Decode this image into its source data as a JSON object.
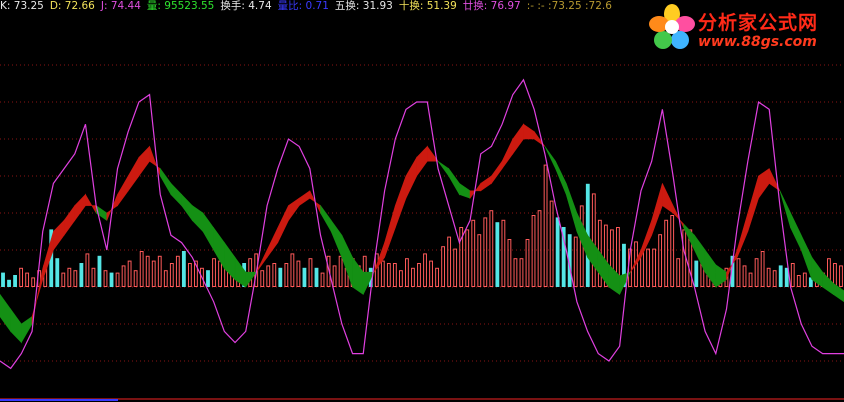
{
  "header": {
    "items": [
      {
        "label": "K",
        "value": "73.25",
        "color": "#e8e8e8"
      },
      {
        "label": "D",
        "value": "72.66",
        "color": "#f2e25a"
      },
      {
        "label": "J",
        "value": "74.44",
        "color": "#e050e0"
      },
      {
        "label": "量",
        "value": "95523.55",
        "color": "#2ee22e"
      },
      {
        "label": "换手",
        "value": "4.74",
        "color": "#e8e8e8"
      },
      {
        "label": "量比",
        "value": "0.71",
        "color": "#3a3aff"
      },
      {
        "label": "五换",
        "value": "31.93",
        "color": "#e8e8e8"
      },
      {
        "label": "十换",
        "value": "51.39",
        "color": "#f2e25a"
      },
      {
        "label": "廿换",
        "value": "76.97",
        "color": "#e050e0"
      }
    ],
    "tail": ":- :- :73.25 :72.6"
  },
  "logo": {
    "title": "分析家公式网",
    "url": "www.88gs.com"
  },
  "chart_data": {
    "type": "bar",
    "ylim": [
      0,
      100
    ],
    "grid": true,
    "colors": {
      "up_bar": "#ff5a5a",
      "down_bar": "#54e6e6",
      "kd_up_fill": "#cc1a10",
      "kd_down_fill": "#149014",
      "j_line": "#e040e0",
      "grid": "#8a1414"
    },
    "bars": [
      {
        "v": 6,
        "up": false
      },
      {
        "v": 3,
        "up": false
      },
      {
        "v": 5,
        "up": false
      },
      {
        "v": 8,
        "up": true
      },
      {
        "v": 6,
        "up": true
      },
      {
        "v": 4,
        "up": true
      },
      {
        "v": 7,
        "up": true
      },
      {
        "v": 9,
        "up": true
      },
      {
        "v": 24,
        "up": false
      },
      {
        "v": 12,
        "up": false
      },
      {
        "v": 6,
        "up": true
      },
      {
        "v": 8,
        "up": true
      },
      {
        "v": 7,
        "up": true
      },
      {
        "v": 10,
        "up": false
      },
      {
        "v": 14,
        "up": true
      },
      {
        "v": 8,
        "up": true
      },
      {
        "v": 13,
        "up": false
      },
      {
        "v": 7,
        "up": true
      },
      {
        "v": 6,
        "up": false
      },
      {
        "v": 6,
        "up": true
      },
      {
        "v": 9,
        "up": true
      },
      {
        "v": 11,
        "up": true
      },
      {
        "v": 7,
        "up": true
      },
      {
        "v": 15,
        "up": true
      },
      {
        "v": 13,
        "up": true
      },
      {
        "v": 11,
        "up": true
      },
      {
        "v": 13,
        "up": true
      },
      {
        "v": 7,
        "up": true
      },
      {
        "v": 10,
        "up": true
      },
      {
        "v": 13,
        "up": true
      },
      {
        "v": 15,
        "up": false
      },
      {
        "v": 10,
        "up": true
      },
      {
        "v": 11,
        "up": true
      },
      {
        "v": 8,
        "up": true
      },
      {
        "v": 7,
        "up": false
      },
      {
        "v": 12,
        "up": true
      },
      {
        "v": 11,
        "up": true
      },
      {
        "v": 10,
        "up": true
      },
      {
        "v": 6,
        "up": true
      },
      {
        "v": 7,
        "up": true
      },
      {
        "v": 10,
        "up": false
      },
      {
        "v": 12,
        "up": true
      },
      {
        "v": 14,
        "up": true
      },
      {
        "v": 7,
        "up": true
      },
      {
        "v": 9,
        "up": true
      },
      {
        "v": 10,
        "up": true
      },
      {
        "v": 8,
        "up": false
      },
      {
        "v": 10,
        "up": true
      },
      {
        "v": 14,
        "up": true
      },
      {
        "v": 11,
        "up": true
      },
      {
        "v": 8,
        "up": false
      },
      {
        "v": 12,
        "up": true
      },
      {
        "v": 8,
        "up": false
      },
      {
        "v": 6,
        "up": true
      },
      {
        "v": 13,
        "up": true
      },
      {
        "v": 9,
        "up": true
      },
      {
        "v": 13,
        "up": true
      },
      {
        "v": 8,
        "up": true
      },
      {
        "v": 12,
        "up": true
      },
      {
        "v": 9,
        "up": true
      },
      {
        "v": 13,
        "up": true
      },
      {
        "v": 8,
        "up": false
      },
      {
        "v": 14,
        "up": true
      },
      {
        "v": 11,
        "up": true
      },
      {
        "v": 10,
        "up": true
      },
      {
        "v": 10,
        "up": true
      },
      {
        "v": 7,
        "up": true
      },
      {
        "v": 12,
        "up": true
      },
      {
        "v": 8,
        "up": true
      },
      {
        "v": 10,
        "up": true
      },
      {
        "v": 14,
        "up": true
      },
      {
        "v": 11,
        "up": true
      },
      {
        "v": 8,
        "up": true
      },
      {
        "v": 17,
        "up": true
      },
      {
        "v": 21,
        "up": true
      },
      {
        "v": 16,
        "up": true
      },
      {
        "v": 25,
        "up": true
      },
      {
        "v": 24,
        "up": true
      },
      {
        "v": 28,
        "up": true
      },
      {
        "v": 22,
        "up": true
      },
      {
        "v": 29,
        "up": true
      },
      {
        "v": 32,
        "up": true
      },
      {
        "v": 27,
        "up": false
      },
      {
        "v": 28,
        "up": true
      },
      {
        "v": 20,
        "up": true
      },
      {
        "v": 12,
        "up": true
      },
      {
        "v": 12,
        "up": true
      },
      {
        "v": 20,
        "up": true
      },
      {
        "v": 30,
        "up": true
      },
      {
        "v": 32,
        "up": true
      },
      {
        "v": 51,
        "up": true
      },
      {
        "v": 36,
        "up": true
      },
      {
        "v": 29,
        "up": false
      },
      {
        "v": 25,
        "up": false
      },
      {
        "v": 22,
        "up": false
      },
      {
        "v": 21,
        "up": true
      },
      {
        "v": 34,
        "up": true
      },
      {
        "v": 43,
        "up": false
      },
      {
        "v": 39,
        "up": true
      },
      {
        "v": 28,
        "up": true
      },
      {
        "v": 26,
        "up": true
      },
      {
        "v": 24,
        "up": true
      },
      {
        "v": 25,
        "up": true
      },
      {
        "v": 18,
        "up": false
      },
      {
        "v": 16,
        "up": true
      },
      {
        "v": 19,
        "up": true
      },
      {
        "v": 15,
        "up": true
      },
      {
        "v": 16,
        "up": true
      },
      {
        "v": 16,
        "up": true
      },
      {
        "v": 22,
        "up": true
      },
      {
        "v": 28,
        "up": true
      },
      {
        "v": 30,
        "up": true
      },
      {
        "v": 12,
        "up": true
      },
      {
        "v": 24,
        "up": true
      },
      {
        "v": 24,
        "up": true
      },
      {
        "v": 11,
        "up": false
      },
      {
        "v": 12,
        "up": true
      },
      {
        "v": 12,
        "up": true
      },
      {
        "v": 5,
        "up": true
      },
      {
        "v": 7,
        "up": true
      },
      {
        "v": 8,
        "up": true
      },
      {
        "v": 13,
        "up": false
      },
      {
        "v": 12,
        "up": true
      },
      {
        "v": 9,
        "up": true
      },
      {
        "v": 6,
        "up": true
      },
      {
        "v": 12,
        "up": true
      },
      {
        "v": 15,
        "up": true
      },
      {
        "v": 8,
        "up": true
      },
      {
        "v": 7,
        "up": true
      },
      {
        "v": 9,
        "up": false
      },
      {
        "v": 8,
        "up": false
      },
      {
        "v": 10,
        "up": true
      },
      {
        "v": 5,
        "up": true
      },
      {
        "v": 6,
        "up": true
      },
      {
        "v": 4,
        "up": false
      },
      {
        "v": 3,
        "up": true
      },
      {
        "v": 6,
        "up": true
      },
      {
        "v": 12,
        "up": true
      },
      {
        "v": 10,
        "up": true
      },
      {
        "v": 9,
        "up": true
      }
    ],
    "k": [
      22,
      18,
      15,
      20,
      35,
      45,
      48,
      52,
      55,
      50,
      48,
      55,
      60,
      65,
      68,
      60,
      55,
      52,
      48,
      45,
      40,
      35,
      32,
      30,
      34,
      40,
      46,
      52,
      54,
      56,
      50,
      45,
      38,
      30,
      28,
      34,
      42,
      52,
      60,
      65,
      68,
      64,
      60,
      55,
      54,
      58,
      60,
      64,
      70,
      74,
      72,
      68,
      62,
      55,
      45,
      38,
      34,
      30,
      28,
      34,
      40,
      48,
      58,
      52,
      46,
      40,
      34,
      30,
      32,
      40,
      50,
      60,
      62,
      56,
      46,
      40,
      32,
      30,
      28,
      26
    ],
    "d": [
      28,
      24,
      20,
      22,
      32,
      40,
      44,
      48,
      52,
      52,
      50,
      52,
      56,
      60,
      64,
      62,
      58,
      55,
      52,
      50,
      46,
      42,
      38,
      34,
      34,
      38,
      42,
      48,
      52,
      54,
      52,
      48,
      44,
      38,
      34,
      34,
      38,
      46,
      54,
      60,
      64,
      64,
      62,
      58,
      56,
      56,
      58,
      62,
      66,
      70,
      70,
      68,
      64,
      58,
      50,
      44,
      40,
      36,
      33,
      34,
      38,
      44,
      52,
      50,
      47,
      44,
      40,
      36,
      34,
      38,
      45,
      54,
      58,
      56,
      50,
      44,
      38,
      34,
      31,
      29
    ],
    "j": [
      10,
      8,
      12,
      18,
      45,
      58,
      62,
      66,
      74,
      52,
      40,
      62,
      72,
      80,
      82,
      55,
      44,
      42,
      38,
      32,
      26,
      18,
      15,
      18,
      34,
      52,
      62,
      70,
      68,
      62,
      44,
      32,
      20,
      12,
      12,
      36,
      56,
      70,
      78,
      80,
      80,
      62,
      52,
      42,
      48,
      66,
      68,
      74,
      82,
      86,
      78,
      66,
      52,
      40,
      26,
      18,
      12,
      10,
      14,
      40,
      56,
      64,
      78,
      60,
      40,
      30,
      18,
      12,
      24,
      46,
      64,
      80,
      78,
      52,
      30,
      20,
      14,
      12,
      12,
      12
    ]
  }
}
